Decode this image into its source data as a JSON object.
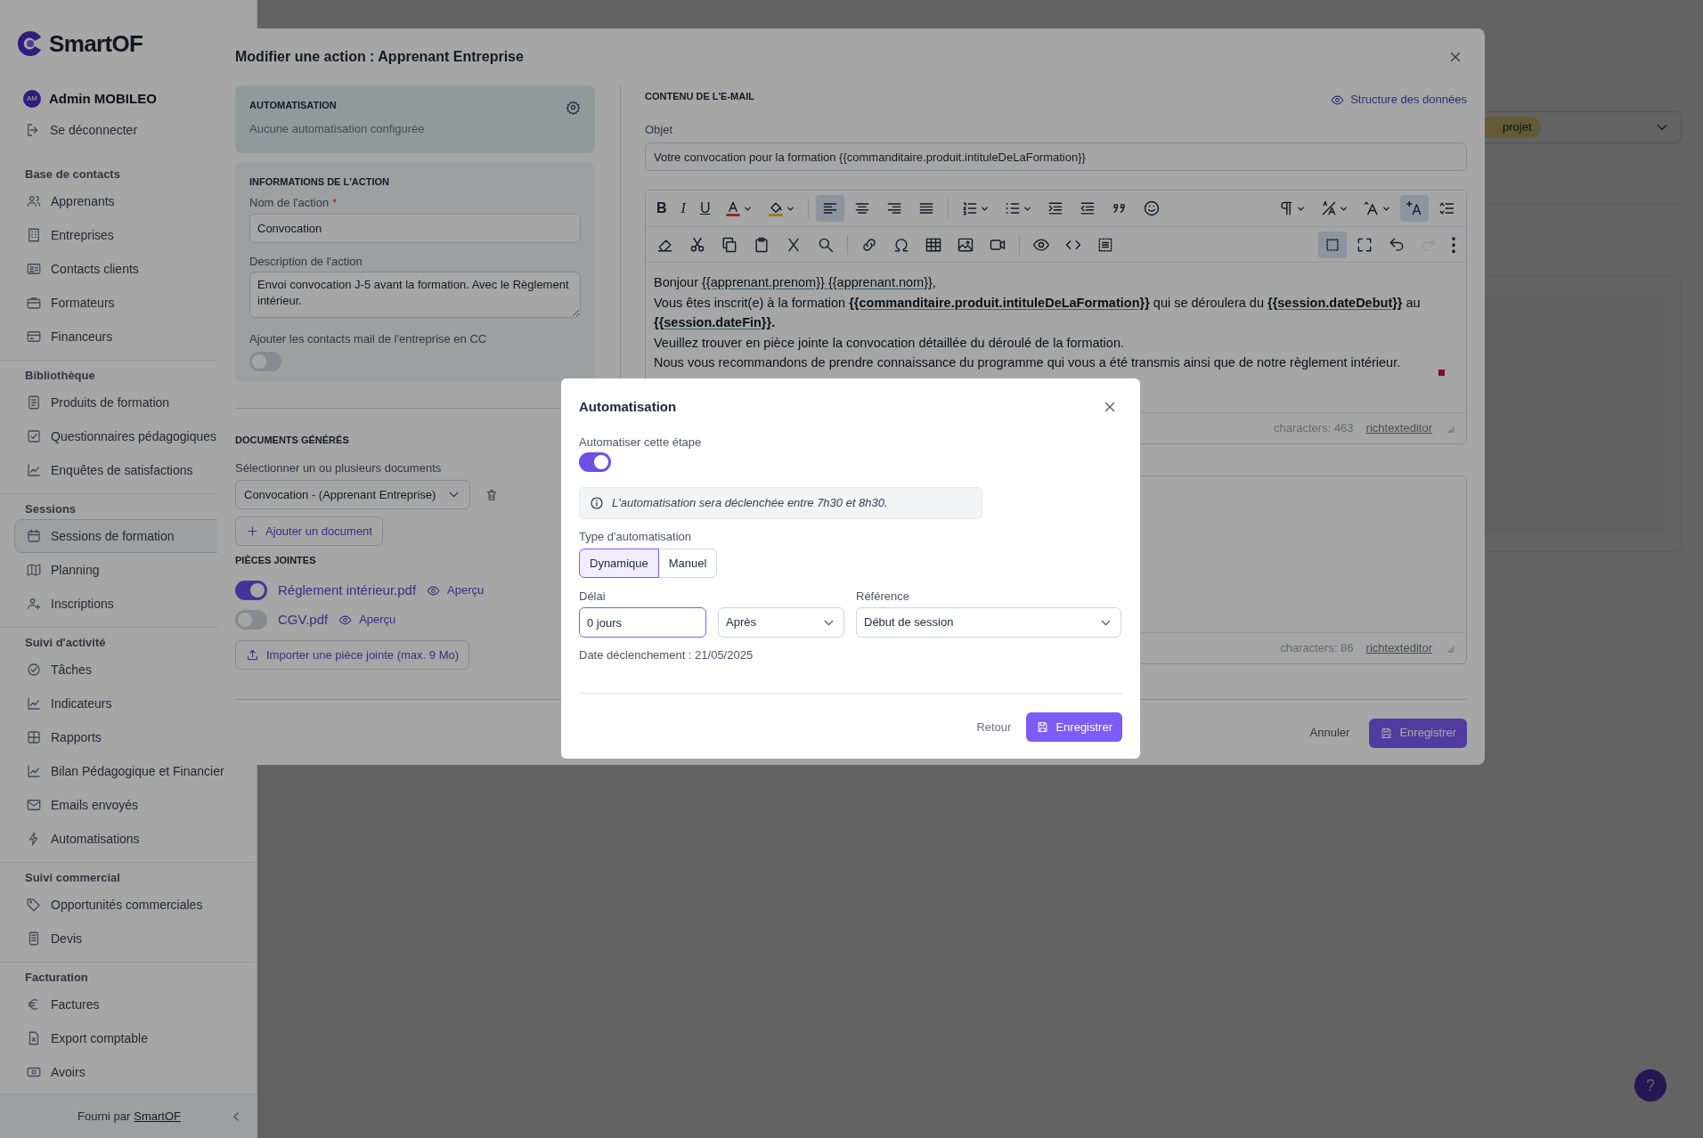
{
  "sidebar": {
    "logo": "SmartOF",
    "user": {
      "initials": "AM",
      "name": "Admin MOBILEO"
    },
    "logout": "Se déconnecter",
    "sections": [
      {
        "title": "Base de contacts",
        "items": [
          {
            "label": "Apprenants",
            "selected": false
          },
          {
            "label": "Entreprises",
            "selected": false
          },
          {
            "label": "Contacts clients",
            "selected": false
          },
          {
            "label": "Formateurs",
            "selected": false
          },
          {
            "label": "Financeurs",
            "selected": false
          }
        ]
      },
      {
        "title": "Bibliothèque",
        "items": [
          {
            "label": "Produits de formation",
            "selected": false
          },
          {
            "label": "Questionnaires pédagogiques",
            "selected": false
          },
          {
            "label": "Enquêtes de satisfactions",
            "selected": false
          }
        ]
      },
      {
        "title": "Sessions",
        "items": [
          {
            "label": "Sessions de formation",
            "selected": true
          },
          {
            "label": "Planning",
            "selected": false
          },
          {
            "label": "Inscriptions",
            "selected": false
          }
        ]
      },
      {
        "title": "Suivi d'activité",
        "items": [
          {
            "label": "Tâches",
            "selected": false
          },
          {
            "label": "Indicateurs",
            "selected": false
          },
          {
            "label": "Rapports",
            "selected": false
          },
          {
            "label": "Bilan Pédagogique et Financier",
            "selected": false
          },
          {
            "label": "Emails envoyés",
            "selected": false
          },
          {
            "label": "Automatisations",
            "selected": false
          }
        ]
      },
      {
        "title": "Suivi commercial",
        "items": [
          {
            "label": "Opportunités commerciales",
            "selected": false
          },
          {
            "label": "Devis",
            "selected": false
          }
        ]
      },
      {
        "title": "Facturation",
        "items": [
          {
            "label": "Factures",
            "selected": false
          },
          {
            "label": "Export comptable",
            "selected": false
          },
          {
            "label": "Avoirs",
            "selected": false
          }
        ]
      }
    ],
    "footer": {
      "prefix": "Fourni par",
      "link": "SmartOF"
    }
  },
  "background": {
    "filter_badge": "projet"
  },
  "help_button": "?",
  "modal": {
    "title": "Modifier une action : Apprenant Entreprise",
    "automation_card": {
      "heading": "AUTOMATISATION",
      "status": "Aucune automatisation configurée"
    },
    "action_info": {
      "heading": "INFORMATIONS DE L'ACTION",
      "name_label": "Nom de l'action",
      "required_mark": "*",
      "name_value": "Convocation",
      "description_label": "Description de l'action",
      "description_value": "Envoi convocation J-5 avant la formation. Avec le Règlement intérieur.",
      "cc_label": "Ajouter les contacts mail de l'entreprise en CC",
      "cc_on": false
    },
    "documents": {
      "heading": "DOCUMENTS GÉNÉRÉS",
      "select_label": "Sélectionner un ou plusieurs documents",
      "selected_document": "Convocation - (Apprenant Entreprise)",
      "add_button": "Ajouter un document"
    },
    "attachments": {
      "heading": "PIÈCES JOINTES",
      "items": [
        {
          "name": "Réglement intérieur.pdf",
          "on": true,
          "preview": "Aperçu"
        },
        {
          "name": "CGV.pdf",
          "on": false,
          "preview": "Aperçu"
        }
      ],
      "import_button": "Importer une pièce jointe (max. 9 Mo)"
    },
    "email": {
      "heading": "CONTENU DE L'E-MAIL",
      "data_link": "Structure des données",
      "subject_label": "Objet",
      "subject": "Votre convocation pour la formation {{commanditaire.produit.intituleDeLaFormation}}",
      "toolbar": [
        [
          {
            "kind": "text",
            "label": "B",
            "active": false,
            "disabled": false
          },
          {
            "kind": "text",
            "label": "I",
            "active": false,
            "disabled": false
          },
          {
            "kind": "text",
            "label": "U",
            "active": false,
            "disabled": false
          },
          {
            "kind": "dropdown",
            "active": false,
            "disabled": false
          },
          {
            "kind": "dropdown",
            "active": false,
            "disabled": false
          },
          {
            "kind": "button",
            "active": true,
            "disabled": false
          },
          {
            "kind": "button",
            "active": false,
            "disabled": false
          },
          {
            "kind": "button",
            "active": false,
            "disabled": false
          },
          {
            "kind": "button",
            "active": false,
            "disabled": false
          },
          {
            "kind": "dropdown",
            "active": false,
            "disabled": false
          },
          {
            "kind": "dropdown",
            "active": false,
            "disabled": false
          },
          {
            "kind": "button",
            "active": false,
            "disabled": false
          },
          {
            "kind": "button",
            "active": false,
            "disabled": false
          },
          {
            "kind": "button",
            "active": false,
            "disabled": false
          },
          {
            "kind": "button",
            "active": false,
            "disabled": false
          },
          {
            "kind": "dropdown",
            "active": false,
            "disabled": false
          },
          {
            "kind": "dropdown",
            "active": false,
            "disabled": false
          },
          {
            "kind": "dropdown",
            "active": false,
            "disabled": false
          },
          {
            "kind": "button",
            "active": true,
            "disabled": false
          },
          {
            "kind": "button",
            "active": false,
            "disabled": false
          }
        ],
        [
          {
            "kind": "button",
            "active": false,
            "disabled": false
          },
          {
            "kind": "button",
            "active": false,
            "disabled": false
          },
          {
            "kind": "button",
            "active": false,
            "disabled": false
          },
          {
            "kind": "button",
            "active": false,
            "disabled": false
          },
          {
            "kind": "button",
            "active": false,
            "disabled": false
          },
          {
            "kind": "button",
            "active": false,
            "disabled": false
          },
          {
            "kind": "button",
            "active": false,
            "disabled": false
          },
          {
            "kind": "button",
            "active": false,
            "disabled": false
          },
          {
            "kind": "button",
            "active": false,
            "disabled": false
          },
          {
            "kind": "button",
            "active": false,
            "disabled": false
          },
          {
            "kind": "button",
            "active": false,
            "disabled": false
          },
          {
            "kind": "button",
            "active": false,
            "disabled": false
          },
          {
            "kind": "button",
            "active": false,
            "disabled": false
          },
          {
            "kind": "button",
            "active": false,
            "disabled": false
          },
          {
            "kind": "button",
            "active": true,
            "disabled": false
          },
          {
            "kind": "button",
            "active": false,
            "disabled": false
          },
          {
            "kind": "button",
            "active": false,
            "disabled": false
          },
          {
            "kind": "button",
            "active": false,
            "disabled": true
          },
          {
            "kind": "button",
            "active": false,
            "disabled": false
          }
        ]
      ],
      "body": [
        {
          "segments": [
            {
              "kind": "plain",
              "text": "Bonjour "
            },
            {
              "kind": "variable",
              "text": "{{apprenant.prenom}} {{apprenant.nom}}"
            },
            {
              "kind": "plain",
              "text": ","
            }
          ]
        },
        {
          "segments": [
            {
              "kind": "plain",
              "text": "Vous êtes inscrit(e) à la formation "
            },
            {
              "kind": "bold_variable",
              "text": "{{commanditaire.produit.intituleDeLaFormation}}"
            },
            {
              "kind": "plain",
              "text": " qui se déroulera du "
            },
            {
              "kind": "bold_variable",
              "text": "{{session.dateDebut}}"
            },
            {
              "kind": "plain",
              "text": " au "
            },
            {
              "kind": "bold_variable",
              "text": "{{session.dateFin}}"
            },
            {
              "kind": "bold",
              "text": "."
            }
          ]
        },
        {
          "segments": [
            {
              "kind": "plain",
              "text": "Veuillez trouver en pièce jointe la convocation détaillée du déroulé de la formation."
            }
          ]
        },
        {
          "segments": [
            {
              "kind": "plain",
              "text": "Nous vous recommandons de prendre connaissance du programme qui vous a été transmis ainsi que de notre règlement intérieur."
            }
          ]
        }
      ],
      "counter": "characters: 463",
      "editor_link": "richtexteditor"
    },
    "second_editor": {
      "counter": "characters: 86",
      "editor_link": "richtexteditor"
    },
    "cancel": "Annuler",
    "save": "Enregistrer"
  },
  "dialog": {
    "title": "Automatisation",
    "toggle_label": "Automatiser cette étape",
    "automate": true,
    "info": "L'automatisation sera déclenchée entre 7h30 et 8h30.",
    "type_label": "Type d'automatisation",
    "types": [
      {
        "label": "Dynamique",
        "selected": true
      },
      {
        "label": "Manuel",
        "selected": false
      }
    ],
    "delay_label": "Délai",
    "delay": "0 jours",
    "direction": "Après",
    "reference_label": "Référence",
    "reference": "Début de session",
    "trigger_date": "Date déclenchement : 21/05/2025",
    "back": "Retour",
    "save": "Enregistrer"
  }
}
